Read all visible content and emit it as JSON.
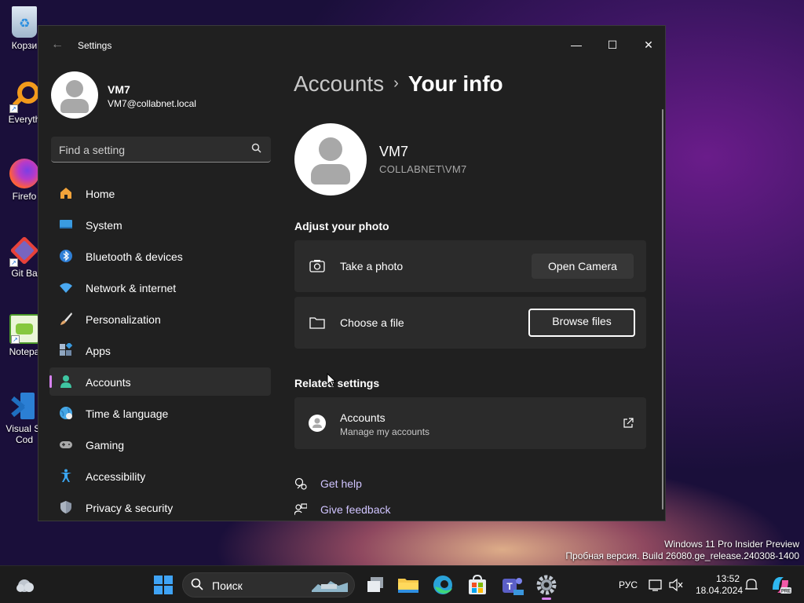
{
  "desktop": {
    "icons": [
      {
        "label": "Корзи",
        "name": "recycle-bin"
      },
      {
        "label": "Everyth",
        "name": "everything"
      },
      {
        "label": "Firefo",
        "name": "firefox"
      },
      {
        "label": "Git Ba",
        "name": "git-bash"
      },
      {
        "label": "Notepa",
        "name": "notepad-plus-plus"
      },
      {
        "label": "Visual St",
        "label2": "Cod",
        "name": "visual-studio-code"
      }
    ]
  },
  "window": {
    "title": "Settings",
    "controls": {
      "minimize": "—",
      "maximize": "☐",
      "close": "✕"
    }
  },
  "profile": {
    "name": "VM7",
    "email": "VM7@collabnet.local"
  },
  "search": {
    "placeholder": "Find a setting"
  },
  "nav": [
    {
      "label": "Home",
      "icon": "home-icon",
      "color": "#f2a33a"
    },
    {
      "label": "System",
      "icon": "system-icon",
      "color": "#3a9be0"
    },
    {
      "label": "Bluetooth & devices",
      "icon": "bluetooth-icon",
      "color": "#2f7fd6"
    },
    {
      "label": "Network & internet",
      "icon": "network-icon",
      "color": "#4aa8f0"
    },
    {
      "label": "Personalization",
      "icon": "brush-icon",
      "color": "#e2a66a"
    },
    {
      "label": "Apps",
      "icon": "apps-icon",
      "color": "#8fa6c0"
    },
    {
      "label": "Accounts",
      "icon": "accounts-icon",
      "color": "#3fc6a2",
      "active": true
    },
    {
      "label": "Time & language",
      "icon": "globe-icon",
      "color": "#46a7e6"
    },
    {
      "label": "Gaming",
      "icon": "gamepad-icon",
      "color": "#a9a9a9"
    },
    {
      "label": "Accessibility",
      "icon": "accessibility-icon",
      "color": "#3aa6f2"
    },
    {
      "label": "Privacy & security",
      "icon": "shield-icon",
      "color": "#8c96a6"
    }
  ],
  "breadcrumb": {
    "parent": "Accounts",
    "separator": "›",
    "current": "Your info"
  },
  "user": {
    "name": "VM7",
    "domain": "COLLABNET\\VM7"
  },
  "adjust_photo": {
    "heading": "Adjust your photo",
    "take_photo": {
      "label": "Take a photo",
      "button": "Open Camera"
    },
    "choose_file": {
      "label": "Choose a file",
      "button": "Browse files"
    }
  },
  "related": {
    "heading": "Related settings",
    "accounts": {
      "title": "Accounts",
      "subtitle": "Manage my accounts"
    }
  },
  "help_links": {
    "get_help": "Get help",
    "give_feedback": "Give feedback"
  },
  "watermark": {
    "line1": "Windows 11 Pro Insider Preview",
    "line2": "Пробная версия. Build 26080.ge_release.240308-1400"
  },
  "taskbar": {
    "search_placeholder": "Поиск",
    "language": "РУС",
    "time": "13:52",
    "date": "18.04.2024"
  },
  "colors": {
    "accent": "#d782f0",
    "link": "#d0c4ff",
    "window_bg": "#202020",
    "card_bg": "#2b2b2b"
  }
}
